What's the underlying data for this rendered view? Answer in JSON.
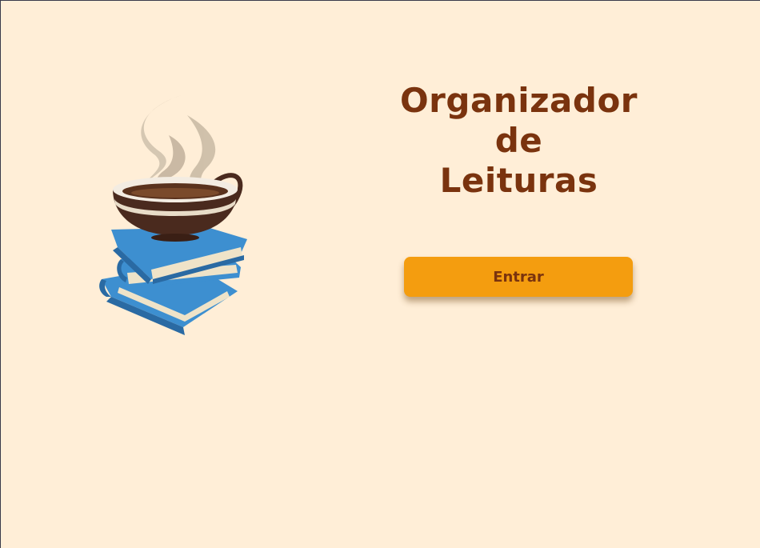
{
  "title": {
    "line1": "Organizador",
    "line2": "de",
    "line3": "Leituras"
  },
  "enter_button": {
    "label": "Entrar"
  },
  "illustration": {
    "icon": "coffee-cup-on-books-icon"
  },
  "colors": {
    "background": "#ffeed7",
    "title": "#7a330e",
    "button": "#f49d0f",
    "button_text": "#7a330e"
  }
}
